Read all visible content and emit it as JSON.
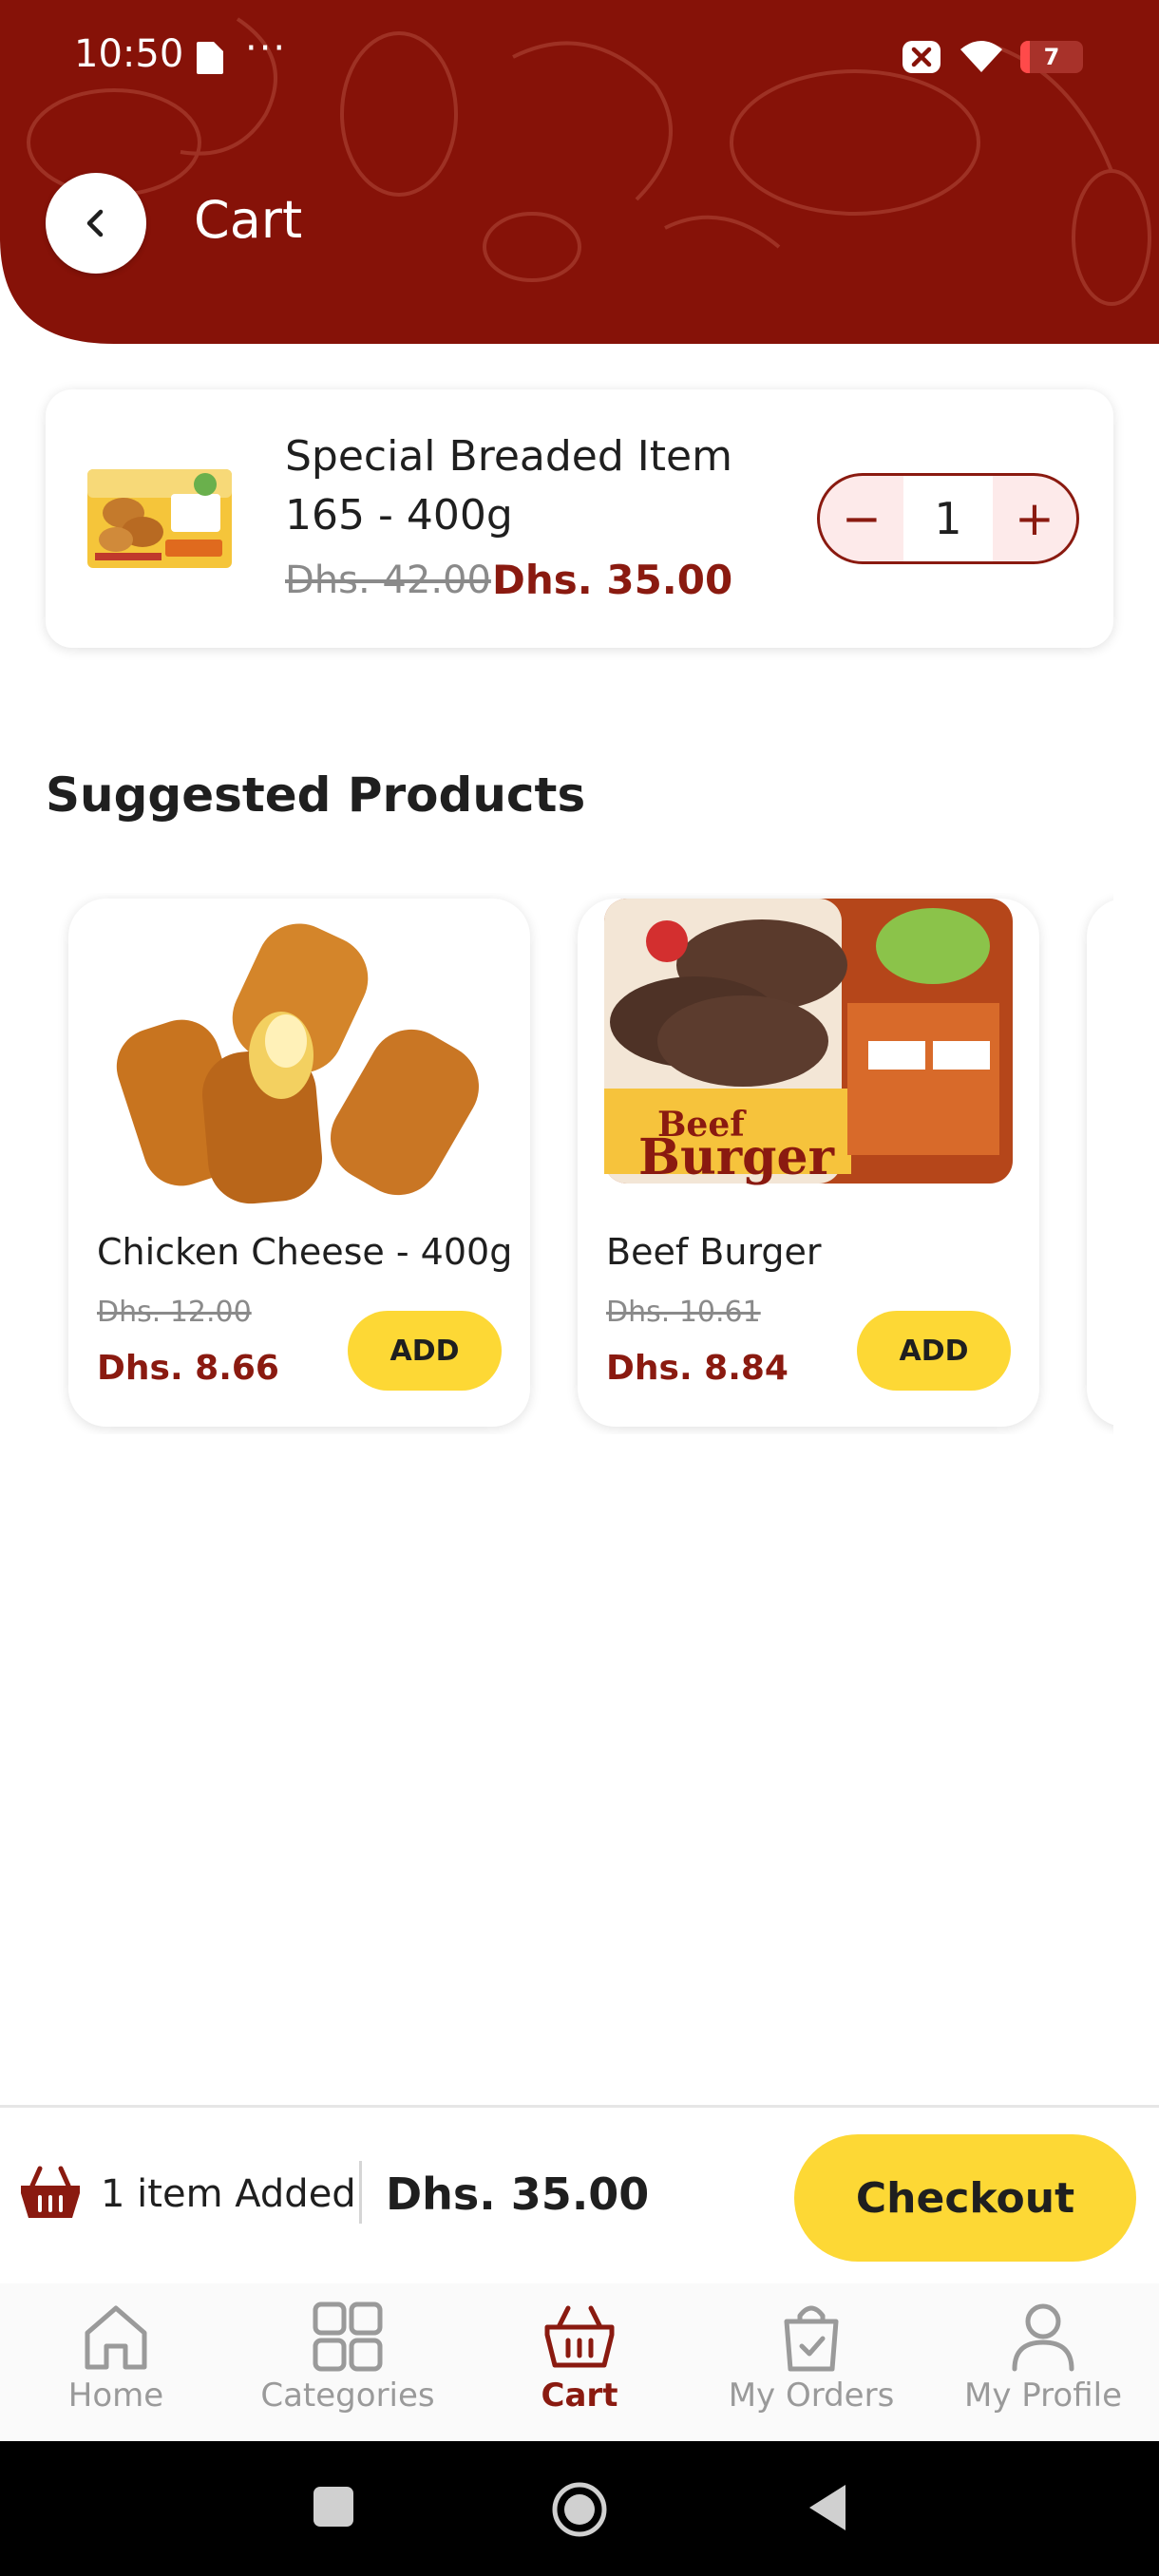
{
  "status_bar": {
    "time": "10:50",
    "dots": "···",
    "battery": "7"
  },
  "header": {
    "title": "Cart",
    "background_color": "#861208"
  },
  "cart_item": {
    "name": "Special Breaded Item 165 - 400g",
    "old_price": "Dhs. 42.00",
    "price": "Dhs. 35.00",
    "quantity": "1",
    "decrement": "−",
    "increment": "+"
  },
  "suggested": {
    "title": "Suggested Products",
    "products": [
      {
        "name": "Chicken Cheese - 400g",
        "old_price": "Dhs. 12.00",
        "price": "Dhs. 8.66",
        "add_label": "ADD"
      },
      {
        "name": "Beef Burger",
        "old_price": "Dhs. 10.61",
        "price": "Dhs. 8.84",
        "add_label": "ADD"
      }
    ]
  },
  "summary": {
    "items_added": "1 item Added",
    "total": "Dhs. 35.00",
    "checkout_label": "Checkout"
  },
  "nav": {
    "items": [
      {
        "label": "Home",
        "icon": "home-icon"
      },
      {
        "label": "Categories",
        "icon": "grid-icon"
      },
      {
        "label": "Cart",
        "icon": "basket-icon"
      },
      {
        "label": "My Orders",
        "icon": "bag-icon"
      },
      {
        "label": "My Profile",
        "icon": "person-icon"
      }
    ],
    "active": "Cart"
  },
  "colors": {
    "brand": "#861208",
    "accent": "#fdd835",
    "inactive": "#9a9a9a"
  }
}
